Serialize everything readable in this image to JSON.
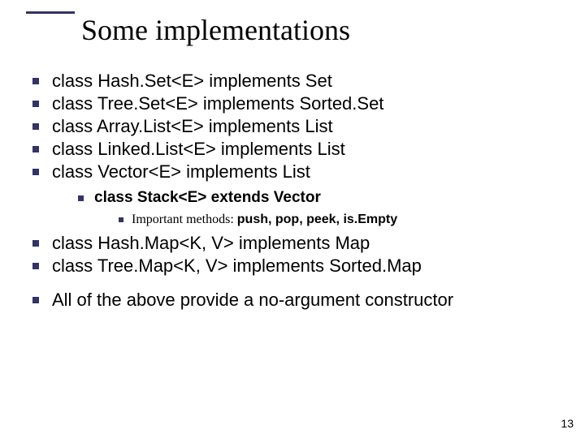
{
  "title": "Some implementations",
  "bullets": [
    "class Hash.Set<E> implements Set",
    "class Tree.Set<E> implements Sorted.Set",
    "class Array.List<E> implements List",
    "class Linked.List<E> implements List",
    "class Vector<E> implements List",
    "class Hash.Map<K, V> implements Map",
    "class Tree.Map<K, V> implements Sorted.Map"
  ],
  "sub": [
    {
      "text": "class Stack<E> extends Vector",
      "sub": [
        {
          "prefix": "Important methods: ",
          "methods": "push, pop, peek, is.Empty"
        }
      ]
    }
  ],
  "closing": "All of the above provide a no-argument constructor",
  "page": "13",
  "accent": "#333366"
}
